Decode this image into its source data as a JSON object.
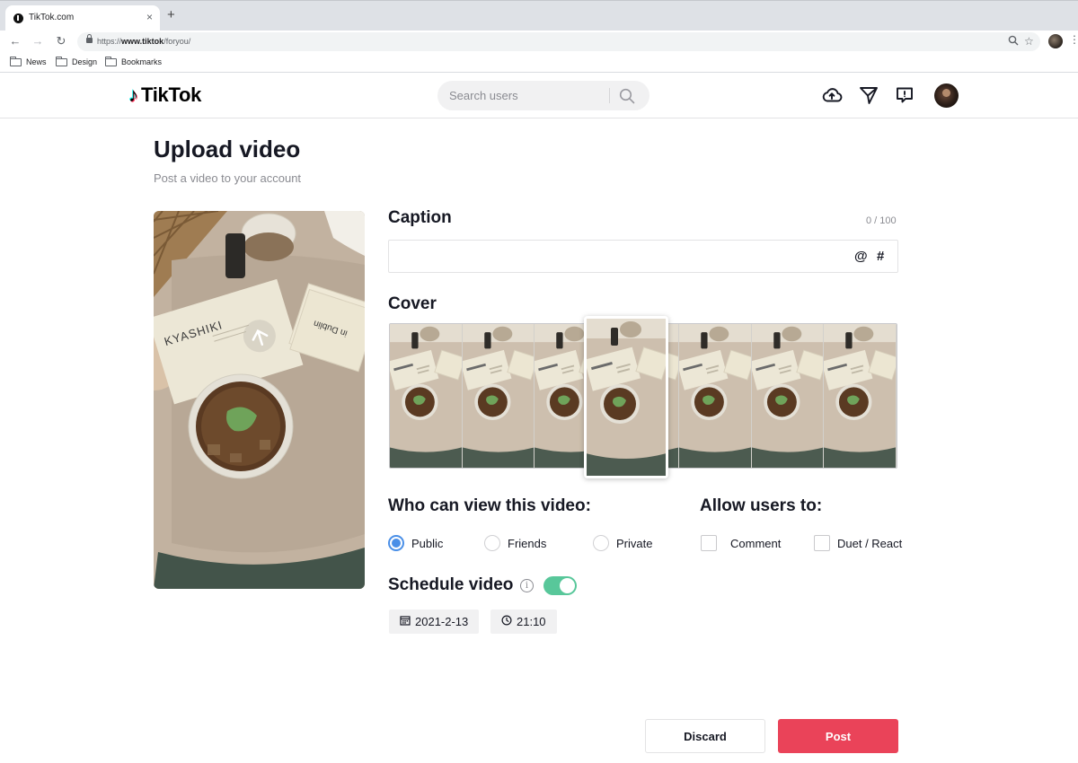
{
  "browser": {
    "tab_title": "TikTok.com",
    "tab_close": "×",
    "new_tab": "+",
    "url_prefix": "https://",
    "url_host": "www.tiktok",
    "url_path": "/foryou/",
    "bookmarks": [
      "News",
      "Design",
      "Bookmarks"
    ]
  },
  "header": {
    "logo_text": "TikTok",
    "search_placeholder": "Search users",
    "icons": [
      "upload-cloud-icon",
      "inbox-send-icon",
      "messages-icon"
    ]
  },
  "upload": {
    "title": "Upload video",
    "subtitle": "Post a video to your account",
    "preview_card": {
      "brand": "KYASHIKI",
      "back_text": "in Dublin"
    }
  },
  "caption": {
    "label": "Caption",
    "count": "0 / 100",
    "value": "",
    "mention_symbol": "@",
    "hashtag_symbol": "#"
  },
  "cover": {
    "label": "Cover",
    "frame_count": 7,
    "selected_frame": 3
  },
  "visibility": {
    "label": "Who can view this video:",
    "options": [
      "Public",
      "Friends",
      "Private"
    ],
    "selected": "Public"
  },
  "allow": {
    "label": "Allow users to:",
    "options": [
      {
        "label": "Comment",
        "checked": false
      },
      {
        "label": "Duet / React",
        "checked": false
      }
    ]
  },
  "schedule": {
    "label": "Schedule video",
    "info_symbol": "i",
    "enabled": true,
    "date": "2021-2-13",
    "time": "21:10"
  },
  "actions": {
    "discard": "Discard",
    "post": "Post"
  },
  "colors": {
    "accent": "#ea4359",
    "toggle_on": "#58c79a",
    "radio_selected": "#4a8fe7",
    "text_primary": "#161823",
    "text_secondary": "#8a8b91"
  }
}
